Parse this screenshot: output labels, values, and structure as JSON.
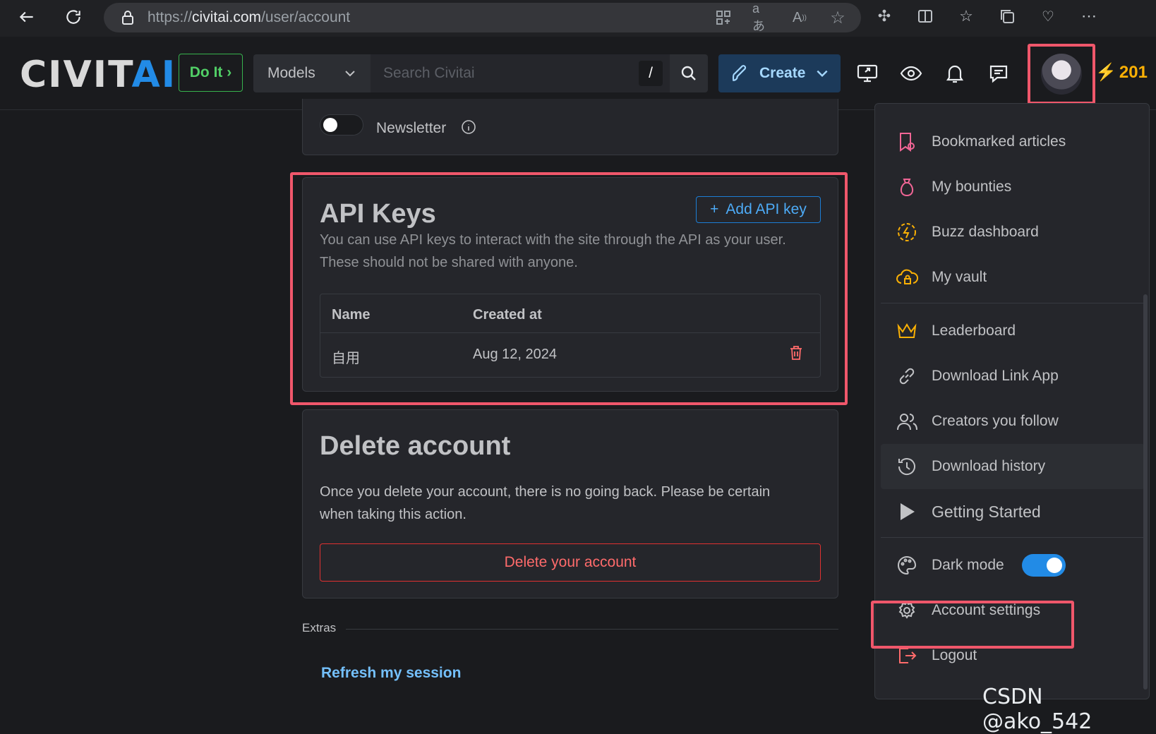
{
  "browser": {
    "url_prefix": "https://",
    "url_host": "civitai.com",
    "url_path": "/user/account"
  },
  "header": {
    "logo_left": "CIVIT",
    "logo_right": "AI",
    "do_it": "Do It",
    "models": "Models",
    "search_placeholder": "Search Civitai",
    "slash": "/",
    "create": "Create",
    "buzz": "201"
  },
  "newsletter": {
    "label": "Newsletter"
  },
  "api_keys": {
    "title": "API Keys",
    "add_label": "Add API key",
    "desc1": "You can use API keys to interact with the site through the API as your user.",
    "desc2": "These should not be shared with anyone.",
    "col_name": "Name",
    "col_created": "Created at",
    "rows": [
      {
        "name": "自用",
        "created": "Aug 12, 2024"
      }
    ]
  },
  "delete": {
    "title": "Delete account",
    "desc1": "Once you delete your account, there is no going back. Please be certain",
    "desc2": "when taking this action.",
    "button": "Delete your account"
  },
  "extras": {
    "label": "Extras",
    "refresh": "Refresh my session"
  },
  "menu": {
    "items": [
      {
        "label": "Bookmarked articles",
        "icon": "bookmark-icon"
      },
      {
        "label": "My bounties",
        "icon": "moneybag-icon"
      },
      {
        "label": "Buzz dashboard",
        "icon": "bolt-icon"
      },
      {
        "label": "My vault",
        "icon": "cloud-lock-icon"
      },
      {
        "label": "Leaderboard",
        "icon": "crown-icon"
      },
      {
        "label": "Download Link App",
        "icon": "link-icon"
      },
      {
        "label": "Creators you follow",
        "icon": "users-icon"
      },
      {
        "label": "Download history",
        "icon": "history-icon"
      },
      {
        "label": "Getting Started",
        "icon": "play-icon"
      },
      {
        "label": "Dark mode",
        "icon": "palette-icon"
      },
      {
        "label": "Account settings",
        "icon": "gear-icon"
      },
      {
        "label": "Logout",
        "icon": "logout-icon"
      }
    ]
  },
  "watermark": "CSDN @ako_542",
  "colors": {
    "accent": "#228be6",
    "highlight": "#f0576b",
    "danger": "#ff6b6b",
    "buzz": "#fab005"
  }
}
